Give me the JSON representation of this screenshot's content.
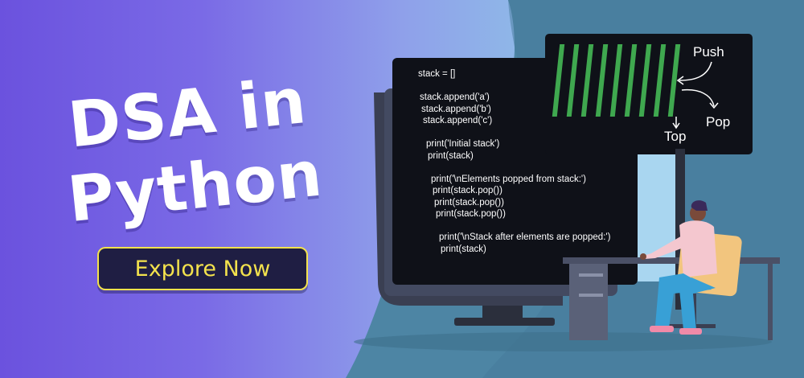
{
  "banner": {
    "title_line1": "DSA in",
    "title_line2": "Python",
    "cta_label": "Explore Now"
  },
  "code_lines": [
    "stack = []",
    "",
    "stack.append('a')",
    "stack.append('b')",
    "stack.append('c')",
    "",
    "print('Initial stack')",
    "print(stack)",
    "",
    "print('\\nElements popped from stack:')",
    "print(stack.pop())",
    "print(stack.pop())",
    "print(stack.pop())",
    "",
    "print('\\nStack after elements are popped:')",
    "print(stack)"
  ],
  "stack_diagram": {
    "push_label": "Push",
    "pop_label": "Pop",
    "top_label": "Top",
    "bar_color": "#3fa84f"
  },
  "colors": {
    "cta_text": "#f3e24d",
    "cta_bg": "#1f1e43",
    "screen_bg": "#0f1118"
  }
}
